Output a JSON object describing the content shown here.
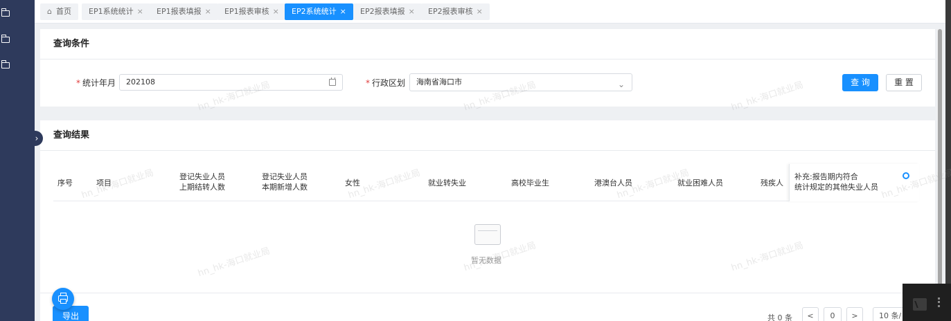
{
  "tabs": [
    {
      "label": "首页",
      "closable": false,
      "active": false
    },
    {
      "label": "EP1系统统计",
      "closable": true,
      "active": false
    },
    {
      "label": "EP1报表填报",
      "closable": true,
      "active": false
    },
    {
      "label": "EP1报表审核",
      "closable": true,
      "active": false
    },
    {
      "label": "EP2系统统计",
      "closable": true,
      "active": true
    },
    {
      "label": "EP2报表填报",
      "closable": true,
      "active": false
    },
    {
      "label": "EP2报表审核",
      "closable": true,
      "active": false
    }
  ],
  "tab_close_glyph": "×",
  "query": {
    "title": "查询条件",
    "month_label": "统计年月",
    "month_value": "202108",
    "region_label": "行政区划",
    "region_value": "海南省海口市",
    "required_mark": "*",
    "search_button": "查 询",
    "reset_button": "重 置"
  },
  "results": {
    "title": "查询结果",
    "columns": [
      {
        "line1": "序号",
        "line2": ""
      },
      {
        "line1": "项目",
        "line2": ""
      },
      {
        "line1": "登记失业人员",
        "line2": "上期结转人数"
      },
      {
        "line1": "登记失业人员",
        "line2": "本期新增人数"
      },
      {
        "line1": "女性",
        "line2": ""
      },
      {
        "line1": "就业转失业",
        "line2": ""
      },
      {
        "line1": "高校毕业生",
        "line2": ""
      },
      {
        "line1": "港澳台人员",
        "line2": ""
      },
      {
        "line1": "就业困难人员",
        "line2": ""
      },
      {
        "line1": "残疾人",
        "line2": ""
      }
    ],
    "fixed_column": {
      "line1": "补充:报告期内符合",
      "line2": "统计规定的其他失业人员"
    },
    "rows": [],
    "empty_text": "暂无数据",
    "export_button": "导出"
  },
  "pagination": {
    "total_text": "共 0 条",
    "prev": "<",
    "current_page": "0",
    "next": ">",
    "page_size": "10 条/"
  },
  "watermark_text": "hn_hk-海口就业局",
  "accent_color": "#1890ff",
  "sidebar_bg": "#2e3a5c"
}
